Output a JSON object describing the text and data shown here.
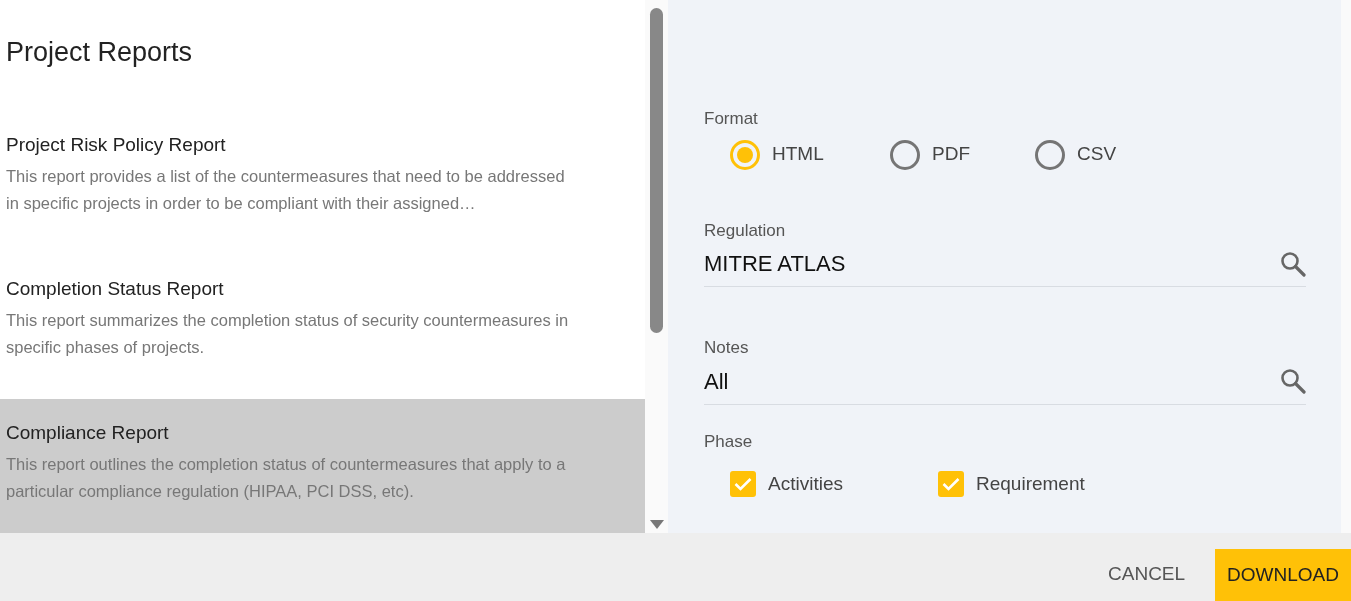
{
  "title": "Project Reports",
  "reports": [
    {
      "name": "Project Risk Policy Report",
      "description": "This report provides a list of the countermeasures that need to be addressed in specific projects in order to be compliant with their assigned…",
      "selected": false
    },
    {
      "name": "Completion Status Report",
      "description": "This report summarizes the completion status of security countermeasures in specific phases of projects.",
      "selected": false
    },
    {
      "name": "Compliance Report",
      "description": "This report outlines the completion status of countermeasures that apply to a particular compliance regulation (HIPAA, PCI DSS, etc).",
      "selected": true
    }
  ],
  "format": {
    "label": "Format",
    "options": [
      {
        "label": "HTML",
        "selected": true
      },
      {
        "label": "PDF",
        "selected": false
      },
      {
        "label": "CSV",
        "selected": false
      }
    ]
  },
  "regulation": {
    "label": "Regulation",
    "value": "MITRE ATLAS"
  },
  "notes": {
    "label": "Notes",
    "value": "All"
  },
  "phase": {
    "label": "Phase",
    "options": [
      {
        "label": "Activities",
        "checked": true
      },
      {
        "label": "Requirement",
        "checked": true
      }
    ]
  },
  "buttons": {
    "cancel": "CANCEL",
    "download": "DOWNLOAD"
  }
}
